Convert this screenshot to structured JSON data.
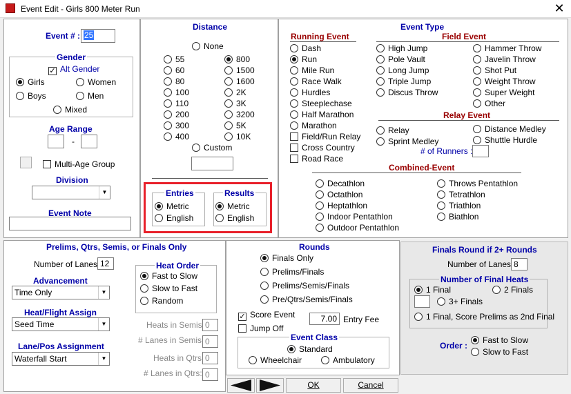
{
  "window": {
    "title": "Event Edit  -  Girls 800 Meter Run"
  },
  "event": {
    "label": "Event # :",
    "number": "25"
  },
  "gender": {
    "title": "Gender",
    "alt_gender": "Alt Gender",
    "girls": "Girls",
    "women": "Women",
    "boys": "Boys",
    "men": "Men",
    "mixed": "Mixed"
  },
  "age_range": {
    "title": "Age Range",
    "separator": "-",
    "from": "",
    "to": ""
  },
  "multi_age": {
    "label": "Multi-Age Group"
  },
  "division": {
    "title": "Division",
    "value": ""
  },
  "event_note": {
    "title": "Event Note",
    "value": ""
  },
  "distance": {
    "title": "Distance",
    "none": "None",
    "left": [
      "55",
      "60",
      "80",
      "100",
      "110",
      "200",
      "300",
      "400"
    ],
    "right": [
      "800",
      "1500",
      "1600",
      "2K",
      "3K",
      "3200",
      "5K",
      "10K"
    ],
    "selected": "800",
    "custom": "Custom",
    "custom_value": ""
  },
  "entries": {
    "title": "Entries",
    "metric": "Metric",
    "english": "English"
  },
  "results": {
    "title": "Results",
    "metric": "Metric",
    "english": "English"
  },
  "event_type": {
    "title": "Event Type",
    "running": {
      "title": "Running Event",
      "items": [
        "Dash",
        "Run",
        "Mile Run",
        "Race Walk",
        "Hurdles",
        "Steeplechase",
        "Half Marathon",
        "Marathon"
      ],
      "selected": "Run",
      "checks": [
        "Field/Run Relay",
        "Cross Country",
        "Road Race"
      ]
    },
    "field": {
      "title": "Field Event",
      "col1": [
        "High Jump",
        "Pole Vault",
        "Long Jump",
        "Triple Jump",
        "Discus Throw"
      ],
      "col2": [
        "Hammer Throw",
        "Javelin Throw",
        "Shot Put",
        "Weight Throw",
        "Super Weight",
        "Other"
      ]
    },
    "relay": {
      "title": "Relay Event",
      "relay": "Relay",
      "sprint_medley": "Sprint Medley",
      "distance_medley": "Distance Medley",
      "shuttle_hurdle": "Shuttle Hurdle",
      "runners_label": "# of Runners :",
      "runners_value": ""
    },
    "combined": {
      "title": "Combined-Event",
      "col1": [
        "Decathlon",
        "Octathlon",
        "Heptathlon",
        "Indoor Pentathlon",
        "Outdoor Pentathlon"
      ],
      "col2": [
        "Throws Pentathlon",
        "Tetrathlon",
        "Triathlon",
        "Biathlon"
      ]
    }
  },
  "prelims": {
    "title": "Prelims, Qtrs, Semis, or Finals Only",
    "lanes_label": "Number of Lanes :",
    "lanes_value": "12",
    "advancement": {
      "title": "Advancement",
      "value": "Time Only"
    },
    "heat_flight": {
      "title": "Heat/Flight Assign",
      "value": "Seed Time"
    },
    "lane_pos": {
      "title": "Lane/Pos Assignment",
      "value": "Waterfall Start"
    },
    "heat_order": {
      "title": "Heat Order",
      "fast_to_slow": "Fast to Slow",
      "slow_to_fast": "Slow to Fast",
      "random": "Random"
    },
    "heats_semis": {
      "label": "Heats in Semis:",
      "value": "0"
    },
    "lanes_semis": {
      "label": "# Lanes in Semis:",
      "value": "0"
    },
    "heats_qtrs": {
      "label": "Heats in Qtrs:",
      "value": "0"
    },
    "lanes_qtrs": {
      "label": "# Lanes in Qtrs:",
      "value": "0"
    }
  },
  "rounds": {
    "title": "Rounds",
    "options": [
      "Finals Only",
      "Prelims/Finals",
      "Prelims/Semis/Finals",
      "Pre/Qtrs/Semis/Finals"
    ],
    "score_event": "Score Event",
    "jump_off": "Jump Off",
    "entry_fee_value": "7.00",
    "entry_fee_label": "Entry Fee",
    "event_class": {
      "title": "Event Class",
      "standard": "Standard",
      "wheelchair": "Wheelchair",
      "ambulatory": "Ambulatory"
    }
  },
  "finals": {
    "title": "Finals Round if 2+ Rounds",
    "lanes_label": "Number of Lanes :",
    "lanes_value": "8",
    "heats": {
      "title": "Number of Final Heats",
      "one_final": "1 Final",
      "two_finals": "2 Finals",
      "three_plus": "3+ Finals",
      "three_plus_value": "",
      "score_prelims": "1 Final, Score Prelims as 2nd Final"
    },
    "order": {
      "label": "Order :",
      "fast_to_slow": "Fast to Slow",
      "slow_to_fast": "Slow to Fast"
    }
  },
  "buttons": {
    "ok": "OK",
    "cancel": "Cancel"
  },
  "colors": {
    "label_blue": "#0000a8",
    "section_red": "#990000",
    "highlight_red": "#e8202a"
  }
}
